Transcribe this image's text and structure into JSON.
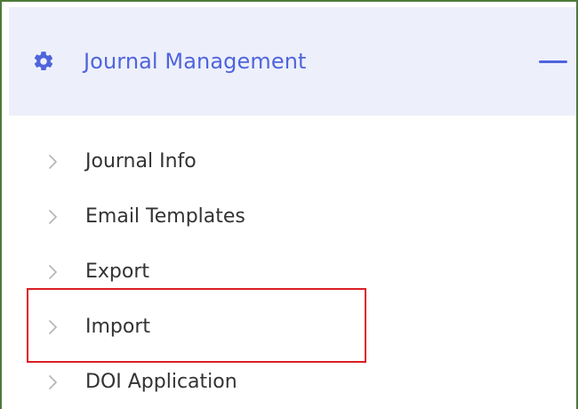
{
  "header": {
    "icon": "gear-icon",
    "title": "Journal Management",
    "action_icon": "minus-icon",
    "accent_color": "#5064dc"
  },
  "menu": {
    "items": [
      {
        "label": "Journal Info",
        "icon": "chevron-right-icon"
      },
      {
        "label": "Email Templates",
        "icon": "chevron-right-icon"
      },
      {
        "label": "Export",
        "icon": "chevron-right-icon"
      },
      {
        "label": "Import",
        "icon": "chevron-right-icon"
      },
      {
        "label": "DOI Application",
        "icon": "chevron-right-icon"
      }
    ]
  },
  "annotation": {
    "highlight_color": "#dd1f23"
  }
}
